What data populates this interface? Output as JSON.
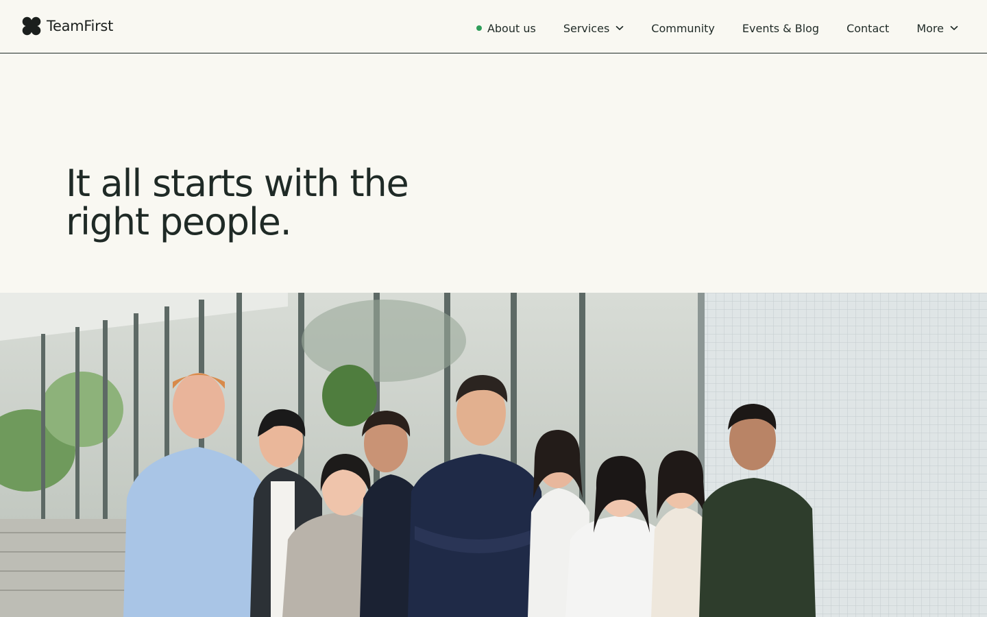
{
  "brand": {
    "name": "TeamFirst",
    "icon": "four-petal-logo-icon"
  },
  "nav": {
    "items": [
      {
        "label": "About us",
        "active": true,
        "indicator_color": "#2f9e5a"
      },
      {
        "label": "Services",
        "dropdown": true,
        "icon": "chevron-down-icon"
      },
      {
        "label": "Community"
      },
      {
        "label": "Events & Blog"
      },
      {
        "label": "Contact"
      },
      {
        "label": "More",
        "dropdown": true,
        "icon": "chevron-down-icon"
      }
    ]
  },
  "hero": {
    "title": "It all starts with the right people."
  },
  "colors": {
    "background": "#f9f8f2",
    "text": "#1f2a26",
    "accent": "#2f9e5a"
  }
}
